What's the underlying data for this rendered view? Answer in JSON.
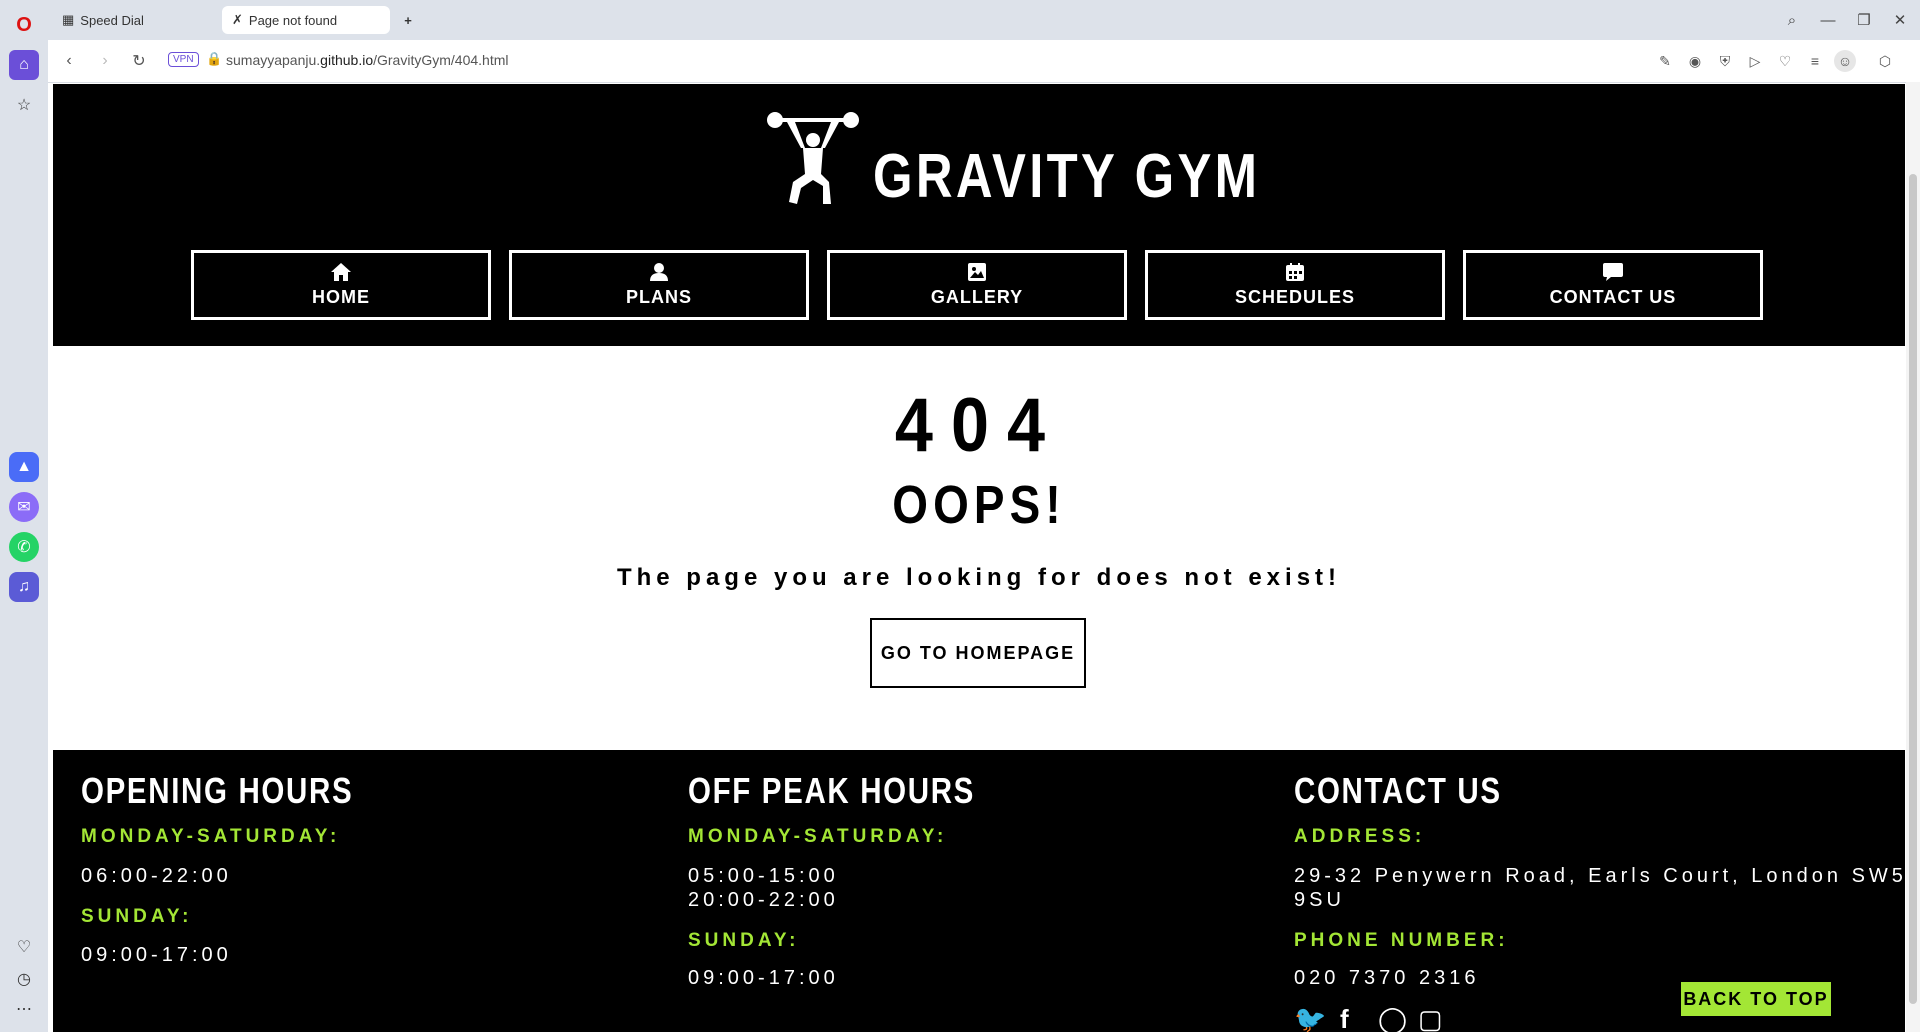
{
  "browser": {
    "tabs": [
      {
        "label": "Speed Dial",
        "active": false
      },
      {
        "label": "Page not found",
        "active": true
      }
    ],
    "vpn_label": "VPN",
    "url_prefix": "sumayyapanju.",
    "url_domain": "github.io",
    "url_path": "/GravityGym/404.html"
  },
  "site": {
    "brand": "GRAVITY GYM",
    "nav": [
      {
        "label": "HOME",
        "icon": "home-icon"
      },
      {
        "label": "PLANS",
        "icon": "user-icon"
      },
      {
        "label": "GALLERY",
        "icon": "image-icon"
      },
      {
        "label": "SCHEDULES",
        "icon": "calendar-icon"
      },
      {
        "label": "CONTACT US",
        "icon": "comment-icon"
      }
    ]
  },
  "error": {
    "code": "404",
    "title": "OOPS!",
    "message": "The page you are looking for does not exist!",
    "button": "GO TO HOMEPAGE"
  },
  "footer": {
    "opening": {
      "title": "OPENING HOURS",
      "weekday_label": "MONDAY-SATURDAY:",
      "weekday_hours": "06:00-22:00",
      "sunday_label": "SUNDAY:",
      "sunday_hours": "09:00-17:00"
    },
    "offpeak": {
      "title": "OFF PEAK HOURS",
      "weekday_label": "MONDAY-SATURDAY:",
      "weekday_hours_1": "05:00-15:00",
      "weekday_hours_2": "20:00-22:00",
      "sunday_label": "SUNDAY:",
      "sunday_hours": "09:00-17:00"
    },
    "contact": {
      "title": "CONTACT US",
      "address_label": "ADDRESS:",
      "address_line1": "29-32 Penywern Road, Earls Court, London SW5",
      "address_line2": "9SU",
      "phone_label": "PHONE NUMBER:",
      "phone": "020 7370 2316"
    },
    "back_to_top": "BACK TO TOP"
  },
  "colors": {
    "accent": "#a3e635",
    "header_bg": "#000000"
  }
}
